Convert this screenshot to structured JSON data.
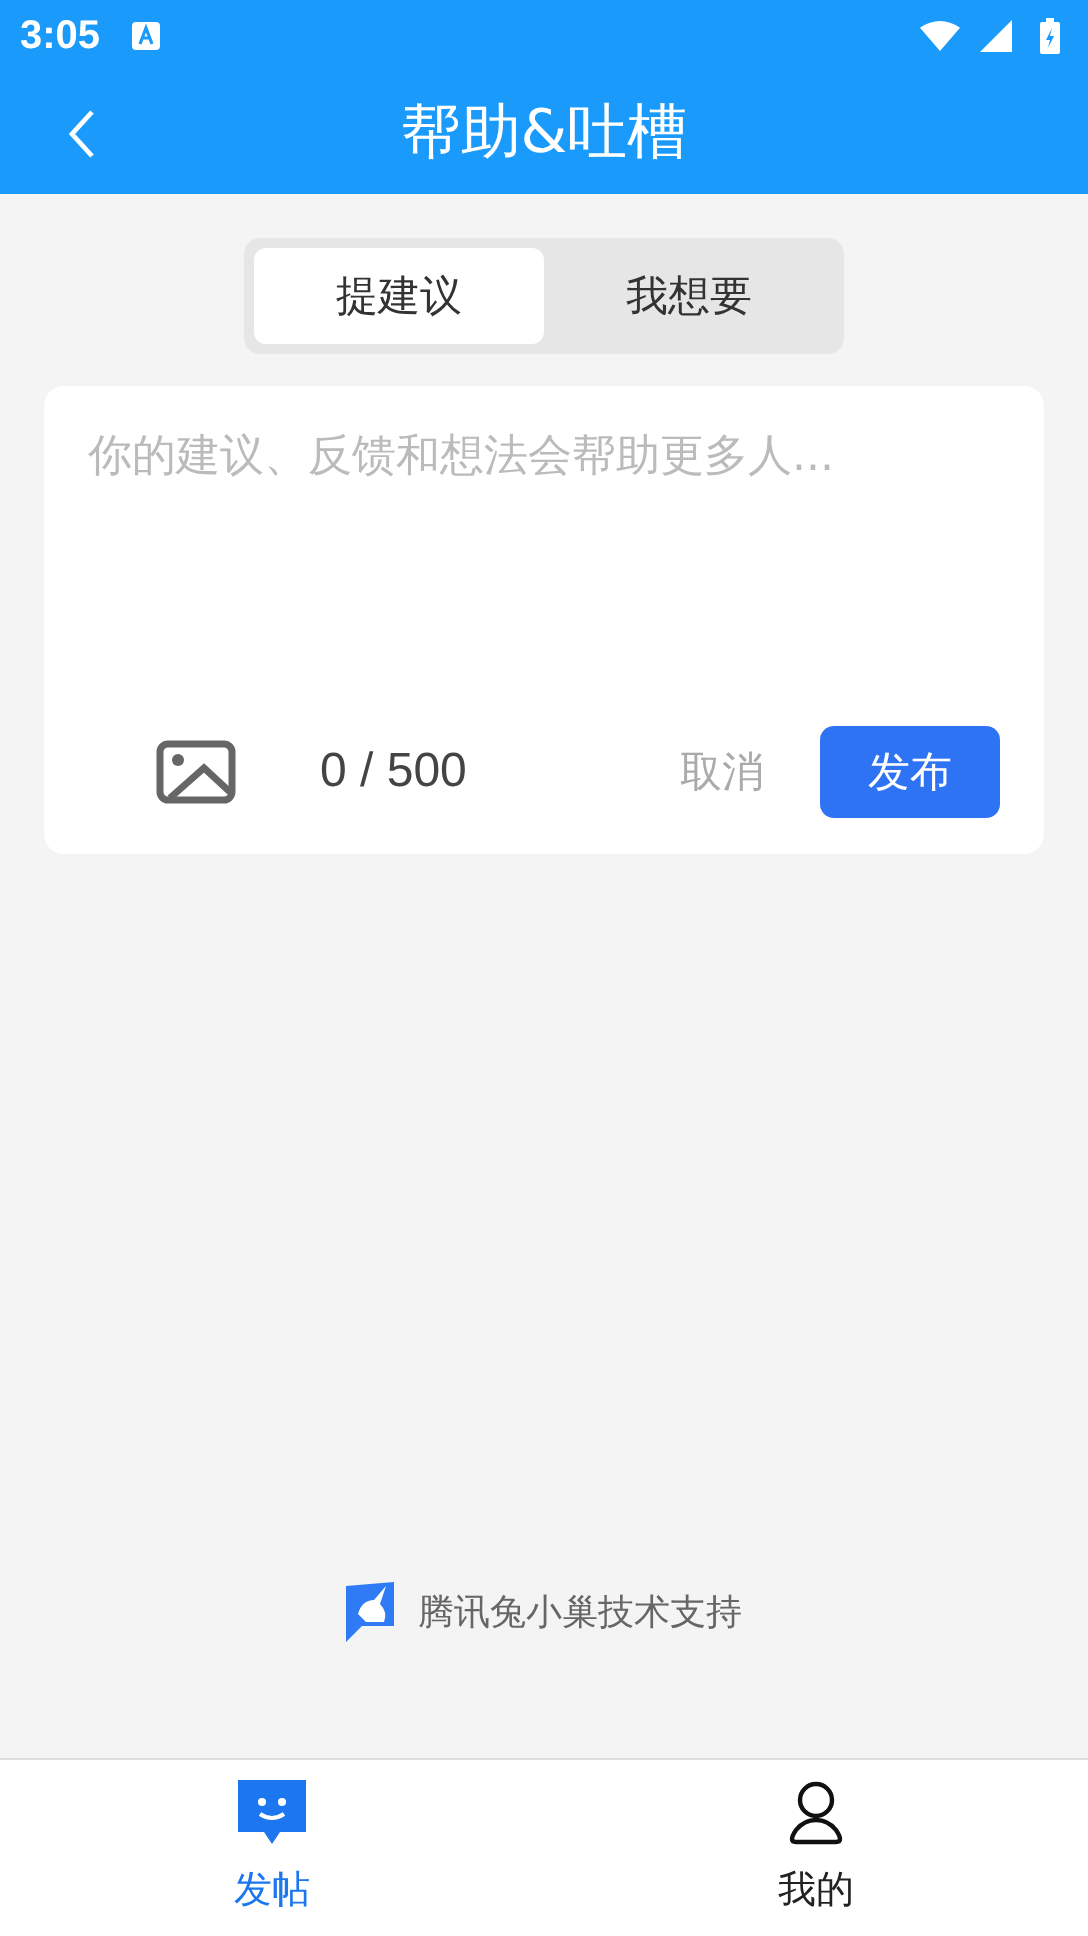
{
  "status_bar": {
    "time": "3:05"
  },
  "header": {
    "title": "帮助&吐槽"
  },
  "tabs": [
    {
      "label": "提建议",
      "selected": true
    },
    {
      "label": "我想要",
      "selected": false
    }
  ],
  "composer": {
    "placeholder": "你的建议、反馈和想法会帮助更多人...",
    "counter": "0 / 500",
    "cancel": "取消",
    "submit": "发布"
  },
  "footer": {
    "credit": "腾讯兔小巢技术支持"
  },
  "bottom_nav": [
    {
      "label": "发帖",
      "kind": "post",
      "selected": true
    },
    {
      "label": "我的",
      "kind": "profile",
      "selected": false
    }
  ]
}
